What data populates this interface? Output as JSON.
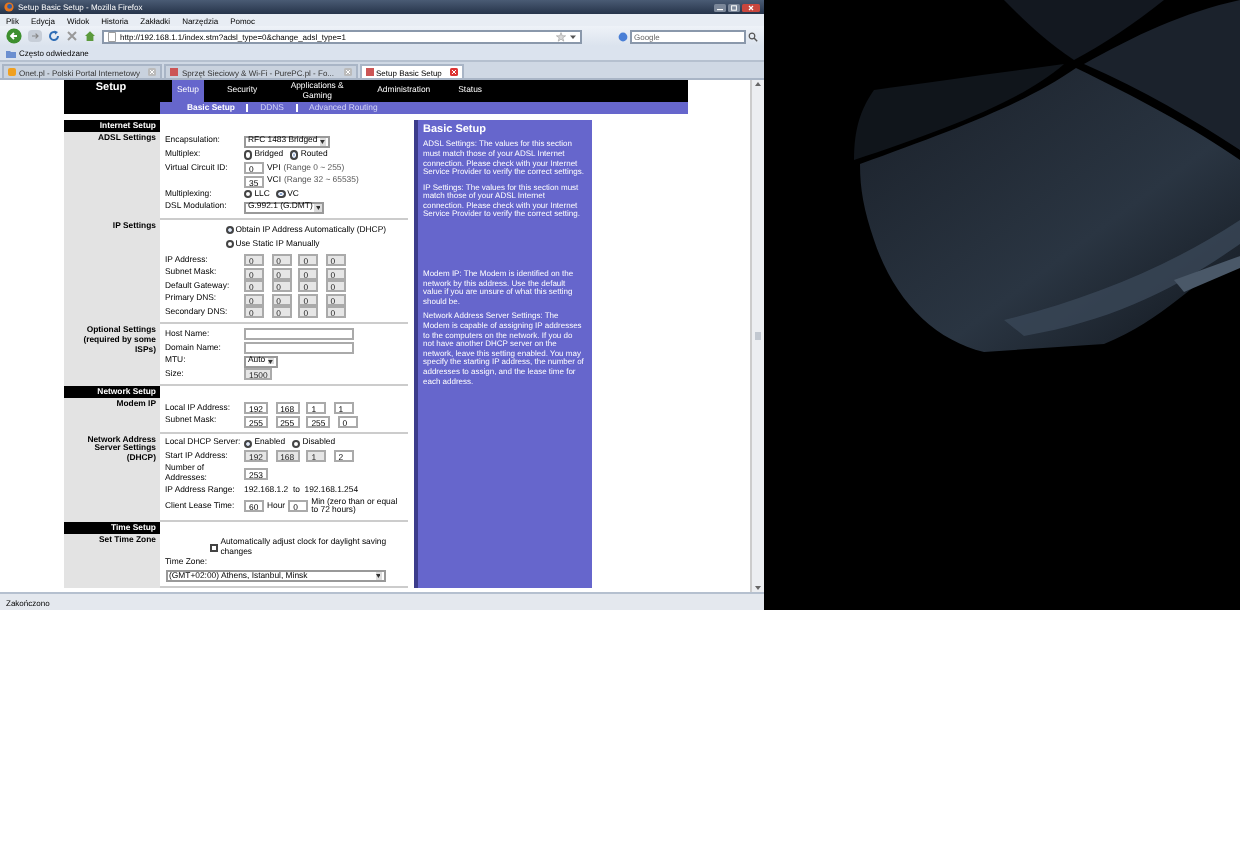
{
  "browser": {
    "title": "Setup Basic Setup - Mozilla Firefox",
    "menu": [
      "Plik",
      "Edycja",
      "Widok",
      "Historia",
      "Zakładki",
      "Narzędzia",
      "Pomoc"
    ],
    "address": "http://192.168.1.1/index.stm?adsl_type=0&change_adsl_type=1",
    "search": {
      "placeholder": "Google"
    },
    "bookmarks": [
      "Często odwiedzane"
    ],
    "tabs": [
      {
        "label": "Onet.pl - Polski Portal Internetowy",
        "selected": false
      },
      {
        "label": "Sprzęt Sieciowy & Wi-Fi - PurePC.pl - Fo...",
        "selected": false
      },
      {
        "label": "Setup Basic Setup",
        "selected": true
      }
    ],
    "status": "Zakończono"
  },
  "router": {
    "brand": "Setup",
    "tabs": [
      {
        "label": "Setup",
        "selected": true
      },
      {
        "label": "Security",
        "selected": false
      },
      {
        "label": "Applications & Gaming",
        "selected": false
      },
      {
        "label": "Administration",
        "selected": false
      },
      {
        "label": "Status",
        "selected": false
      }
    ],
    "subtabs": [
      {
        "label": "Basic Setup",
        "selected": true
      },
      {
        "label": "DDNS",
        "selected": false
      },
      {
        "label": "Advanced Routing",
        "selected": false
      }
    ],
    "sections": [
      {
        "header": "Internet Setup",
        "groups": [
          {
            "label": "ADSL Settings",
            "rows": [
              {
                "kind": "select",
                "label": "Encapsulation:",
                "value": "RFC 1483 Bridged"
              },
              {
                "kind": "radios",
                "label": "Multiplex:",
                "options": [
                  {
                    "label": "Bridged",
                    "selected": false
                  },
                  {
                    "label": "Routed",
                    "selected": true
                  }
                ]
              },
              {
                "kind": "field",
                "label": "Virtual Circuit ID:",
                "inputs": [
                  {
                    "value": "0",
                    "suffix": "VPI",
                    "disabled": false
                  }
                ],
                "hint": "(Range 0 ~ 255)"
              },
              {
                "kind": "field",
                "inputs": [
                  {
                    "value": "35",
                    "suffix": "VCI",
                    "disabled": false
                  }
                ],
                "hint": "(Range 32 ~ 65535)"
              },
              {
                "kind": "radios",
                "label": "Multiplexing:",
                "options": [
                  {
                    "label": "LLC",
                    "selected": false
                  },
                  {
                    "label": "VC",
                    "selected": true
                  }
                ]
              },
              {
                "kind": "select",
                "label": "DSL Modulation:",
                "value": "G.992.1 (G.DMT)"
              }
            ]
          },
          {
            "label": "IP Settings",
            "rows": [
              {
                "kind": "choice",
                "options": [
                  {
                    "label": "Obtain IP Address Automatically (DHCP)",
                    "selected": true
                  },
                  {
                    "label": "Use Static IP Manually",
                    "selected": false
                  }
                ]
              },
              {
                "kind": "ip",
                "label": "IP Address:",
                "octets": [
                  {
                    "value": "0",
                    "disabled": true
                  },
                  {
                    "value": "0",
                    "disabled": true
                  },
                  {
                    "value": "0",
                    "disabled": true
                  },
                  {
                    "value": "0",
                    "disabled": true
                  }
                ]
              },
              {
                "kind": "ip",
                "label": "Subnet Mask:",
                "octets": [
                  {
                    "value": "0",
                    "disabled": true
                  },
                  {
                    "value": "0",
                    "disabled": true
                  },
                  {
                    "value": "0",
                    "disabled": true
                  },
                  {
                    "value": "0",
                    "disabled": true
                  }
                ]
              },
              {
                "kind": "ip",
                "label": "Default Gateway:",
                "octets": [
                  {
                    "value": "0",
                    "disabled": true
                  },
                  {
                    "value": "0",
                    "disabled": true
                  },
                  {
                    "value": "0",
                    "disabled": true
                  },
                  {
                    "value": "0",
                    "disabled": true
                  }
                ]
              },
              {
                "kind": "ip",
                "label": "Primary DNS:",
                "octets": [
                  {
                    "value": "0",
                    "disabled": true
                  },
                  {
                    "value": "0",
                    "disabled": true
                  },
                  {
                    "value": "0",
                    "disabled": true
                  },
                  {
                    "value": "0",
                    "disabled": true
                  }
                ]
              },
              {
                "kind": "ip",
                "label": "Secondary DNS:",
                "octets": [
                  {
                    "value": "0",
                    "disabled": true
                  },
                  {
                    "value": "0",
                    "disabled": true
                  },
                  {
                    "value": "0",
                    "disabled": true
                  },
                  {
                    "value": "0",
                    "disabled": true
                  }
                ]
              }
            ]
          },
          {
            "label": "Optional Settings (required by some ISPs)",
            "rows": [
              {
                "kind": "wide-field",
                "label": "Host Name:"
              },
              {
                "kind": "wide-field",
                "label": "Domain Name:"
              },
              {
                "kind": "select",
                "label": "MTU:",
                "value": "Auto"
              },
              {
                "kind": "field",
                "label": "Size:",
                "inputs": [
                  {
                    "value": "1500",
                    "disabled": true
                  }
                ]
              }
            ]
          }
        ]
      },
      {
        "header": "Network Setup",
        "groups": [
          {
            "label": "Modem IP",
            "rows": [
              {
                "kind": "ip",
                "label": "Local IP Address:",
                "octets": [
                  {
                    "value": "192",
                    "disabled": false
                  },
                  {
                    "value": "168",
                    "disabled": false
                  },
                  {
                    "value": "1",
                    "disabled": false
                  },
                  {
                    "value": "1",
                    "disabled": false
                  }
                ]
              },
              {
                "kind": "ip",
                "label": "Subnet Mask:",
                "octets": [
                  {
                    "value": "255",
                    "disabled": false
                  },
                  {
                    "value": "255",
                    "disabled": false
                  },
                  {
                    "value": "255",
                    "disabled": false
                  },
                  {
                    "value": "0",
                    "disabled": false
                  }
                ]
              }
            ]
          },
          {
            "label": "Network Address Server Settings (DHCP)",
            "rows": [
              {
                "kind": "radios",
                "label": "Local DHCP Server:",
                "options": [
                  {
                    "label": "Enabled",
                    "selected": true
                  },
                  {
                    "label": "Disabled",
                    "selected": false
                  }
                ]
              },
              {
                "kind": "ip",
                "label": "Start IP Address:",
                "octets": [
                  {
                    "value": "192",
                    "disabled": true
                  },
                  {
                    "value": "168",
                    "disabled": true
                  },
                  {
                    "value": "1",
                    "disabled": true
                  },
                  {
                    "value": "2",
                    "disabled": false
                  }
                ]
              },
              {
                "kind": "field",
                "label": "Number of Addresses:",
                "inputs": [
                  {
                    "value": "253",
                    "disabled": false
                  }
                ]
              },
              {
                "kind": "text",
                "label": "IP Address Range:",
                "value": "192.168.1.2  to  192.168.1.254"
              },
              {
                "kind": "field",
                "label": "Client Lease Time:",
                "inputs": [
                  {
                    "value": "60",
                    "suffix": "Hour",
                    "disabled": false
                  },
                  {
                    "value": "0",
                    "suffix": "Min (zero than or equal to 72 hours)",
                    "disabled": false
                  }
                ]
              }
            ]
          }
        ]
      },
      {
        "header": "Time Setup",
        "groups": [
          {
            "label": "Set Time Zone",
            "rows": [
              {
                "kind": "checkbox",
                "label": "Automatically adjust clock for daylight saving changes",
                "checked": false
              },
              {
                "kind": "wide-select",
                "label": "Time Zone:",
                "value": "(GMT+02:00) Athens, Istanbul, Minsk"
              }
            ]
          }
        ]
      }
    ],
    "help": {
      "title": "Basic Setup",
      "blocks": [
        [
          "ADSL Settings: The values for this section must match those of your ADSL Internet connection. Please check with your Internet Service Provider to verify the correct settings.",
          "IP Settings: The values for this section must match those of your ADSL Internet connection. Please check with your Internet Service Provider to verify the correct setting."
        ],
        [
          "Modem IP: The Modem is identified on the network by this address. Use the default value if you are unsure of what this setting should be.",
          "Network Address Server Settings: The Modem is capable of assigning IP addresses to the computers on the network. If you do not have another DHCP server on the network, leave this setting enabled. You may specify the starting IP address, the number of addresses to assign, and the lease time for each address."
        ]
      ]
    }
  }
}
